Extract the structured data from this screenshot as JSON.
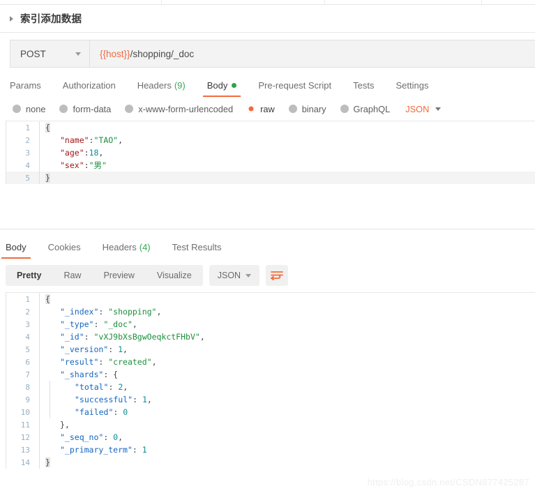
{
  "request": {
    "title": "索引添加数据",
    "collapse_icon": "caret-right-icon",
    "method": "POST",
    "method_caret": "chevron-down-icon",
    "url_variable": "{{host}}",
    "url_path": "/shopping/_doc",
    "tabs": [
      {
        "label": "Params",
        "active": false,
        "count": "",
        "dot": false
      },
      {
        "label": "Authorization",
        "active": false,
        "count": "",
        "dot": false
      },
      {
        "label": "Headers",
        "active": false,
        "count": "(9)",
        "dot": false
      },
      {
        "label": "Body",
        "active": true,
        "count": "",
        "dot": true
      },
      {
        "label": "Pre-request Script",
        "active": false,
        "count": "",
        "dot": false
      },
      {
        "label": "Tests",
        "active": false,
        "count": "",
        "dot": false
      },
      {
        "label": "Settings",
        "active": false,
        "count": "",
        "dot": false
      }
    ],
    "body_types": [
      {
        "label": "none",
        "selected": false
      },
      {
        "label": "form-data",
        "selected": false
      },
      {
        "label": "x-www-form-urlencoded",
        "selected": false
      },
      {
        "label": "raw",
        "selected": true
      },
      {
        "label": "binary",
        "selected": false
      },
      {
        "label": "GraphQL",
        "selected": false
      }
    ],
    "raw_format": "JSON",
    "body_lines": [
      {
        "num": "1",
        "indent": 0,
        "tokens": [
          {
            "t": "{",
            "c": "p brace-box"
          }
        ]
      },
      {
        "num": "2",
        "indent": 1,
        "tokens": [
          {
            "t": "\"name\"",
            "c": "k"
          },
          {
            "t": ":",
            "c": "p"
          },
          {
            "t": "\"TAO\"",
            "c": "s"
          },
          {
            "t": ",",
            "c": "p"
          }
        ]
      },
      {
        "num": "3",
        "indent": 1,
        "tokens": [
          {
            "t": "\"age\"",
            "c": "k"
          },
          {
            "t": ":",
            "c": "p"
          },
          {
            "t": "18",
            "c": "n"
          },
          {
            "t": ",",
            "c": "p"
          }
        ]
      },
      {
        "num": "4",
        "indent": 1,
        "tokens": [
          {
            "t": "\"sex\"",
            "c": "k"
          },
          {
            "t": ":",
            "c": "p"
          },
          {
            "t": "\"男\"",
            "c": "s"
          }
        ]
      },
      {
        "num": "5",
        "indent": 0,
        "tokens": [
          {
            "t": "}",
            "c": "p brace-box"
          }
        ]
      }
    ]
  },
  "response": {
    "tabs": [
      {
        "label": "Body",
        "active": true,
        "count": ""
      },
      {
        "label": "Cookies",
        "active": false,
        "count": ""
      },
      {
        "label": "Headers",
        "active": false,
        "count": "(4)"
      },
      {
        "label": "Test Results",
        "active": false,
        "count": ""
      }
    ],
    "view_modes": [
      {
        "label": "Pretty",
        "active": true
      },
      {
        "label": "Raw",
        "active": false
      },
      {
        "label": "Preview",
        "active": false
      },
      {
        "label": "Visualize",
        "active": false
      }
    ],
    "format": "JSON",
    "format_caret": "chevron-down-icon",
    "wrap_icon": "wrap-lines-icon",
    "body_lines": [
      {
        "num": "1",
        "indent": 0,
        "tokens": [
          {
            "t": "{",
            "c": "p brace-box"
          }
        ]
      },
      {
        "num": "2",
        "indent": 1,
        "tokens": [
          {
            "t": "\"_index\"",
            "c": "rk"
          },
          {
            "t": ": ",
            "c": "p"
          },
          {
            "t": "\"shopping\"",
            "c": "rs"
          },
          {
            "t": ",",
            "c": "p"
          }
        ]
      },
      {
        "num": "3",
        "indent": 1,
        "tokens": [
          {
            "t": "\"_type\"",
            "c": "rk"
          },
          {
            "t": ": ",
            "c": "p"
          },
          {
            "t": "\"_doc\"",
            "c": "rs"
          },
          {
            "t": ",",
            "c": "p"
          }
        ]
      },
      {
        "num": "4",
        "indent": 1,
        "tokens": [
          {
            "t": "\"_id\"",
            "c": "rk"
          },
          {
            "t": ": ",
            "c": "p"
          },
          {
            "t": "\"vXJ9bXsBgwOeqkctFHbV\"",
            "c": "rs"
          },
          {
            "t": ",",
            "c": "p"
          }
        ]
      },
      {
        "num": "5",
        "indent": 1,
        "tokens": [
          {
            "t": "\"_version\"",
            "c": "rk"
          },
          {
            "t": ": ",
            "c": "p"
          },
          {
            "t": "1",
            "c": "rn"
          },
          {
            "t": ",",
            "c": "p"
          }
        ]
      },
      {
        "num": "6",
        "indent": 1,
        "tokens": [
          {
            "t": "\"result\"",
            "c": "rk"
          },
          {
            "t": ": ",
            "c": "p"
          },
          {
            "t": "\"created\"",
            "c": "rs"
          },
          {
            "t": ",",
            "c": "p"
          }
        ]
      },
      {
        "num": "7",
        "indent": 1,
        "tokens": [
          {
            "t": "\"_shards\"",
            "c": "rk"
          },
          {
            "t": ": ",
            "c": "p"
          },
          {
            "t": "{",
            "c": "p"
          }
        ]
      },
      {
        "num": "8",
        "indent": 2,
        "tokens": [
          {
            "t": "\"total\"",
            "c": "rk"
          },
          {
            "t": ": ",
            "c": "p"
          },
          {
            "t": "2",
            "c": "rn"
          },
          {
            "t": ",",
            "c": "p"
          }
        ]
      },
      {
        "num": "9",
        "indent": 2,
        "tokens": [
          {
            "t": "\"successful\"",
            "c": "rk"
          },
          {
            "t": ": ",
            "c": "p"
          },
          {
            "t": "1",
            "c": "rn"
          },
          {
            "t": ",",
            "c": "p"
          }
        ]
      },
      {
        "num": "10",
        "indent": 2,
        "tokens": [
          {
            "t": "\"failed\"",
            "c": "rk"
          },
          {
            "t": ": ",
            "c": "p"
          },
          {
            "t": "0",
            "c": "rn"
          }
        ]
      },
      {
        "num": "11",
        "indent": 1,
        "tokens": [
          {
            "t": "}",
            "c": "p"
          },
          {
            "t": ",",
            "c": "p"
          }
        ]
      },
      {
        "num": "12",
        "indent": 1,
        "tokens": [
          {
            "t": "\"_seq_no\"",
            "c": "rk"
          },
          {
            "t": ": ",
            "c": "p"
          },
          {
            "t": "0",
            "c": "rn"
          },
          {
            "t": ",",
            "c": "p"
          }
        ]
      },
      {
        "num": "13",
        "indent": 1,
        "tokens": [
          {
            "t": "\"_primary_term\"",
            "c": "rk"
          },
          {
            "t": ": ",
            "c": "p"
          },
          {
            "t": "1",
            "c": "rn"
          }
        ]
      },
      {
        "num": "14",
        "indent": 0,
        "tokens": [
          {
            "t": "}",
            "c": "p brace-box"
          }
        ]
      }
    ]
  },
  "watermark": "https://blog.csdn.net/CSDN877425287",
  "colors": {
    "accent": "#f26b3a",
    "green": "#28a745",
    "variable": "#ed6b42"
  }
}
